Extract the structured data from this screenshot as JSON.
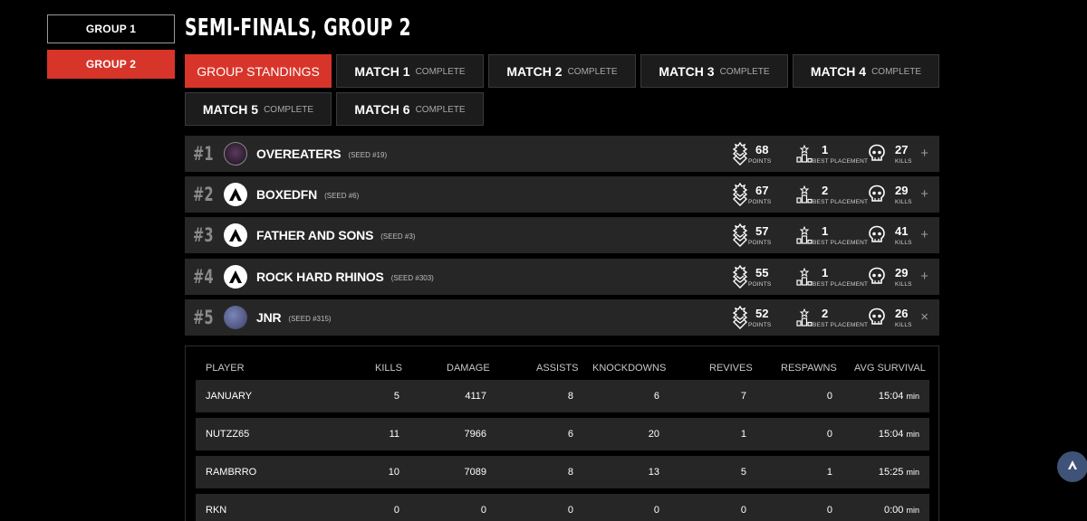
{
  "groups": [
    "GROUP 1",
    "GROUP 2"
  ],
  "page_title": "SEMI-FINALS, GROUP 2",
  "tabs": [
    {
      "label": "GROUP STANDINGS",
      "status": ""
    },
    {
      "label": "MATCH 1",
      "status": "COMPLETE"
    },
    {
      "label": "MATCH 2",
      "status": "COMPLETE"
    },
    {
      "label": "MATCH 3",
      "status": "COMPLETE"
    },
    {
      "label": "MATCH 4",
      "status": "COMPLETE"
    },
    {
      "label": "MATCH 5",
      "status": "COMPLETE"
    },
    {
      "label": "MATCH 6",
      "status": "COMPLETE"
    }
  ],
  "stat_labels": {
    "points": "POINTS",
    "best_placement": "BEST PLACEMENT",
    "kills": "KILLS"
  },
  "teams": [
    {
      "rank": "#1",
      "name": "OVEREATERS",
      "seed": "(SEED #19)",
      "points": "68",
      "best_placement": "1",
      "kills": "27",
      "toggle": "+"
    },
    {
      "rank": "#2",
      "name": "BOXEDFN",
      "seed": "(SEED #6)",
      "points": "67",
      "best_placement": "2",
      "kills": "29",
      "toggle": "+"
    },
    {
      "rank": "#3",
      "name": "FATHER AND SONS",
      "seed": "(SEED #3)",
      "points": "57",
      "best_placement": "1",
      "kills": "41",
      "toggle": "+"
    },
    {
      "rank": "#4",
      "name": "ROCK HARD RHINOS",
      "seed": "(SEED #303)",
      "points": "55",
      "best_placement": "1",
      "kills": "29",
      "toggle": "+"
    },
    {
      "rank": "#5",
      "name": "JNR",
      "seed": "(SEED #315)",
      "points": "52",
      "best_placement": "2",
      "kills": "26",
      "toggle": "×"
    }
  ],
  "player_table": {
    "headers": [
      "PLAYER",
      "KILLS",
      "DAMAGE",
      "ASSISTS",
      "KNOCKDOWNS",
      "REVIVES",
      "RESPAWNS",
      "AVG SURVIVAL"
    ],
    "min_unit": "min",
    "rows": [
      {
        "player": "JANUARY",
        "kills": "5",
        "damage": "4117",
        "assists": "8",
        "knockdowns": "6",
        "revives": "7",
        "respawns": "0",
        "survival": "15:04"
      },
      {
        "player": "NUTZZ65",
        "kills": "11",
        "damage": "7966",
        "assists": "6",
        "knockdowns": "20",
        "revives": "1",
        "respawns": "0",
        "survival": "15:04"
      },
      {
        "player": "RAMBRRO",
        "kills": "10",
        "damage": "7089",
        "assists": "8",
        "knockdowns": "13",
        "revives": "5",
        "respawns": "1",
        "survival": "15:25"
      },
      {
        "player": "RKN",
        "kills": "0",
        "damage": "0",
        "assists": "0",
        "knockdowns": "0",
        "revives": "0",
        "respawns": "0",
        "survival": "0:00"
      }
    ]
  },
  "icons": {
    "points": "chevron-badge-icon",
    "best_placement": "podium-icon",
    "kills": "skull-icon",
    "team_logo": "apex-logo-icon",
    "scroll_top": "arrow-up-icon"
  },
  "colors": {
    "accent": "#d8352a",
    "row_bg": "#262626",
    "scroll_button": "#3f5378"
  }
}
